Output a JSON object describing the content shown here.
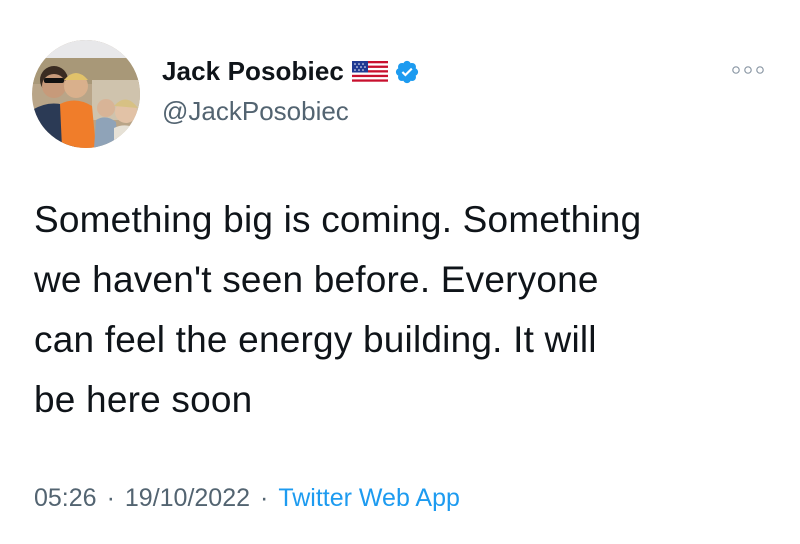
{
  "author": {
    "display_name": "Jack Posobiec",
    "handle": "@JackPosobiec",
    "verified_color": "#1d9bf0",
    "avatar_icon": "profile-photo",
    "flag_icon": "us-flag-icon"
  },
  "tweet": {
    "text": "Something big is coming. Something\nwe haven't seen before. Everyone\ncan feel the energy building. It will\nbe here soon"
  },
  "meta": {
    "time": "05:26",
    "separator": "·",
    "date": "19/10/2022",
    "source": "Twitter Web App"
  },
  "colors": {
    "text": "#0f1419",
    "secondary": "#536471",
    "link": "#1d9bf0"
  }
}
